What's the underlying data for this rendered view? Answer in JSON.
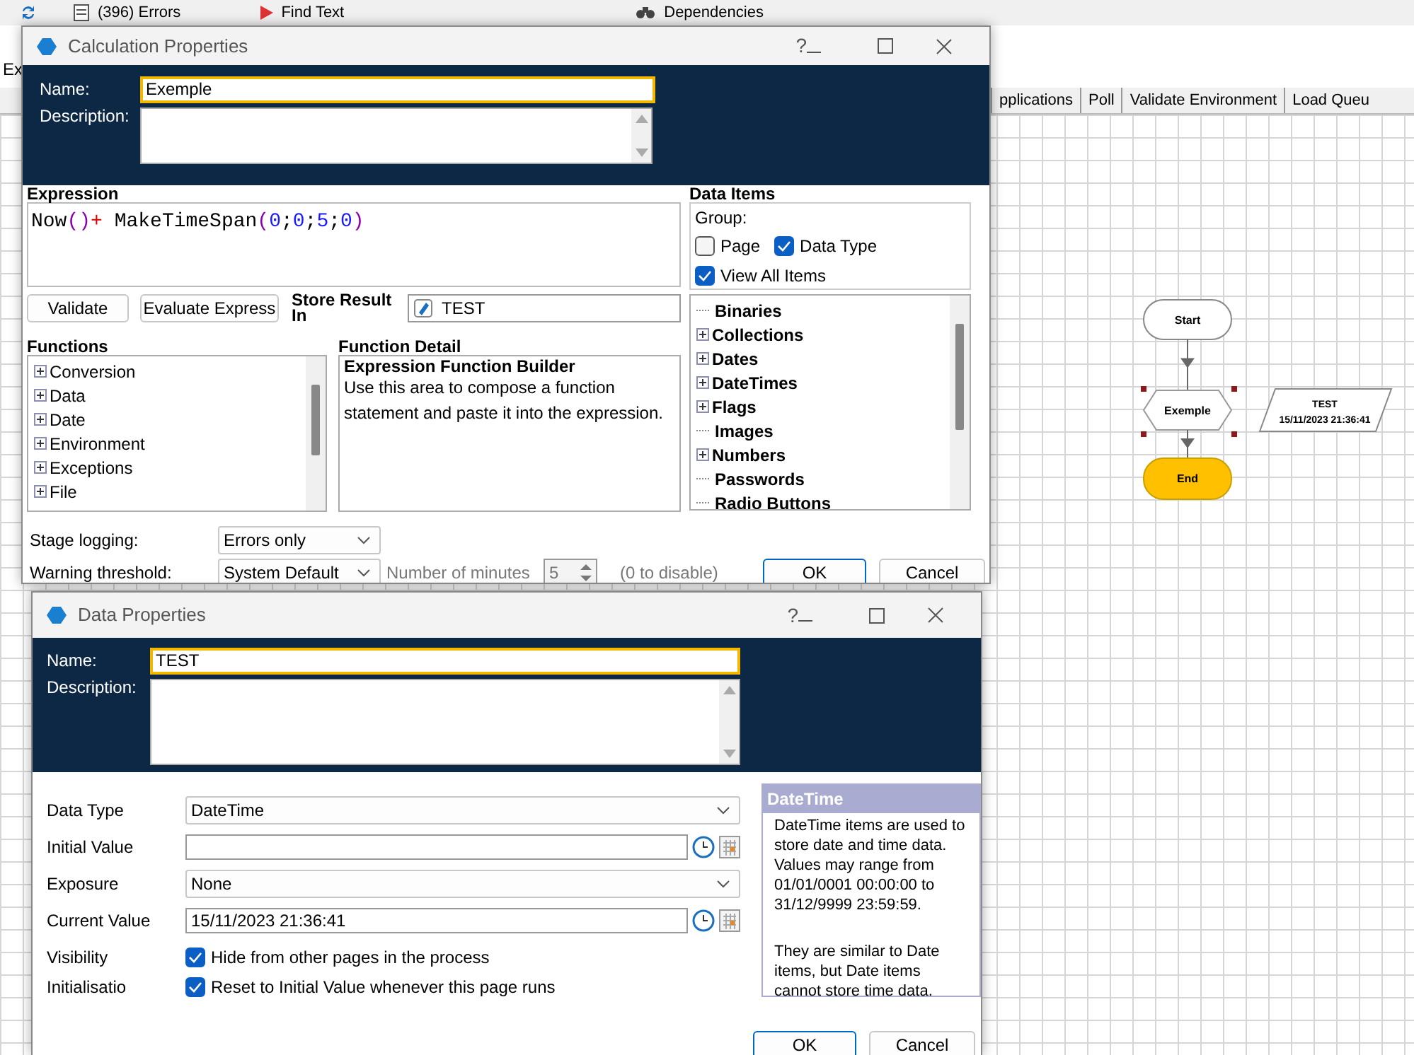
{
  "app": {
    "toolbar": [
      {
        "kind": "errors",
        "label": "(396) Errors"
      },
      {
        "kind": "find",
        "label": "Find Text"
      },
      {
        "kind": "dependencies",
        "label": "Dependencies"
      }
    ],
    "tab_stub": "Ex",
    "tabs": [
      "pplications",
      "Poll",
      "Validate Environment",
      "Load Queu"
    ]
  },
  "flowchart": {
    "nodes": [
      {
        "kind": "start",
        "label": "Start",
        "selected": false
      },
      {
        "kind": "calculation",
        "label": "Exemple",
        "selected": true
      },
      {
        "kind": "end",
        "label": "End",
        "selected": false
      }
    ],
    "data_item": {
      "name": "TEST",
      "value": "15/11/2023 21:36:41"
    }
  },
  "calculation_dialog": {
    "title": "Calculation Properties",
    "help": "?",
    "name_label": "Name:",
    "name": "Exemple",
    "description_label": "Description:",
    "expression_label": "Expression",
    "expression": [
      {
        "kind": "function",
        "text": "Now"
      },
      {
        "kind": "paren",
        "text": "()"
      },
      {
        "kind": "operator",
        "text": "+"
      },
      {
        "kind": "function",
        "text": " MakeTimeSpan"
      },
      {
        "kind": "paren",
        "text": "("
      },
      {
        "kind": "number",
        "text": "0"
      },
      {
        "kind": "separator",
        "text": ";"
      },
      {
        "kind": "number",
        "text": "0"
      },
      {
        "kind": "separator",
        "text": ";"
      },
      {
        "kind": "number",
        "text": "5"
      },
      {
        "kind": "separator",
        "text": ";"
      },
      {
        "kind": "number",
        "text": "0"
      },
      {
        "kind": "paren",
        "text": ")"
      }
    ],
    "validate_button": "Validate",
    "evaluate_button": "Evaluate Express",
    "store_result_label": "Store Result In",
    "store_result": "TEST",
    "functions_label": "Functions",
    "functions": [
      {
        "label": "Conversion",
        "expandable": true
      },
      {
        "label": "Data",
        "expandable": true
      },
      {
        "label": "Date",
        "expandable": true
      },
      {
        "label": "Environment",
        "expandable": true
      },
      {
        "label": "Exceptions",
        "expandable": true
      },
      {
        "label": "File",
        "expandable": true
      }
    ],
    "function_detail_label": "Function Detail",
    "function_detail": {
      "title": "Expression Function Builder",
      "text": "Use this area to compose a function statement and paste it into the expression."
    },
    "data_items_label": "Data Items",
    "group_label": "Group:",
    "group_options": [
      {
        "label": "Page",
        "checked": false
      },
      {
        "label": "Data Type",
        "checked": true
      },
      {
        "label": "View All Items",
        "checked": true
      }
    ],
    "data_items": [
      {
        "label": "Binaries",
        "expandable": false
      },
      {
        "label": "Collections",
        "expandable": true
      },
      {
        "label": "Dates",
        "expandable": true
      },
      {
        "label": "DateTimes",
        "expandable": true
      },
      {
        "label": "Flags",
        "expandable": true
      },
      {
        "label": "Images",
        "expandable": false
      },
      {
        "label": "Numbers",
        "expandable": true
      },
      {
        "label": "Passwords",
        "expandable": false
      },
      {
        "label": "Radio Buttons",
        "expandable": false
      }
    ],
    "stage_logging": {
      "label": "Stage logging:",
      "value": "Errors only"
    },
    "warning_threshold": {
      "label": "Warning threshold:",
      "value": "System Default",
      "minutes_label": "Number of minutes",
      "minutes": "5",
      "hint": "(0 to disable)",
      "disabled": true
    },
    "buttons": [
      "OK",
      "Cancel"
    ]
  },
  "data_dialog": {
    "title": "Data Properties",
    "help": "?",
    "name_label": "Name:",
    "name": "TEST",
    "description_label": "Description:",
    "fields": [
      {
        "kind": "select",
        "label": "Data Type",
        "value": "DateTime"
      },
      {
        "kind": "date",
        "label": "Initial Value"
      },
      {
        "kind": "select",
        "label": "Exposure",
        "value": "None"
      },
      {
        "kind": "date",
        "label": "Current Value",
        "value": "15/11/2023 21:36:41"
      },
      {
        "kind": "checkbox",
        "label": "Visibility",
        "text": "Hide from other pages in the process",
        "checked": true
      },
      {
        "kind": "checkbox",
        "label": "Initialisatio",
        "text": "Reset to Initial Value whenever this page runs",
        "checked": true
      }
    ],
    "info": {
      "title": "DateTime",
      "paragraphs": [
        "DateTime items are used to store date and time data. Values may range from 01/01/0001 00:00:00 to 31/12/9999 23:59:59.",
        "They are similar to Date items, but Date items cannot store time data."
      ]
    },
    "buttons": [
      "OK",
      "Cancel"
    ]
  }
}
